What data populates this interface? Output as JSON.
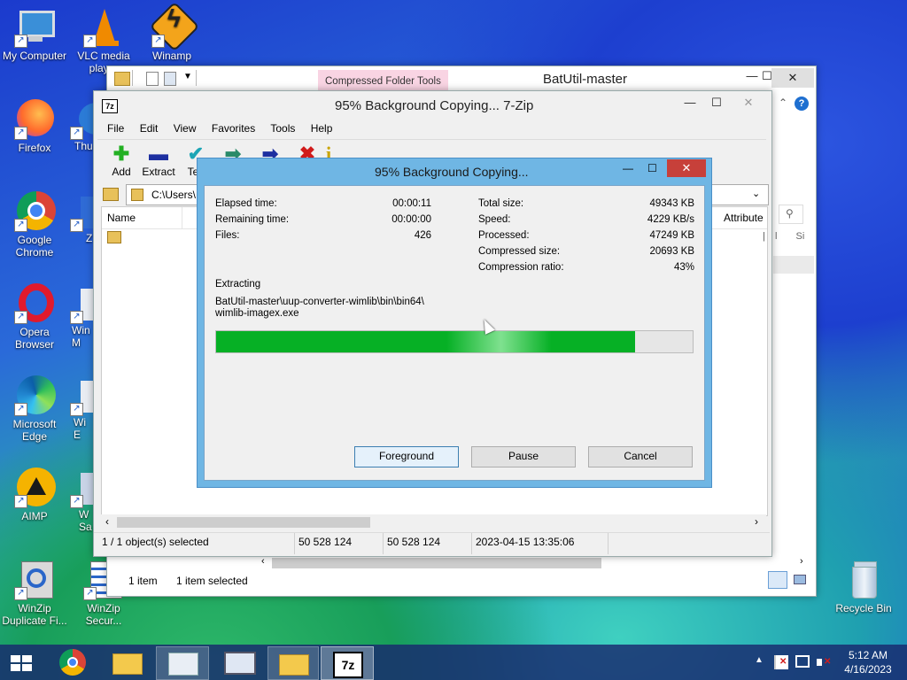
{
  "desktop": {
    "icons": [
      {
        "label": "My Computer"
      },
      {
        "label": "VLC media player"
      },
      {
        "label": "Winamp"
      },
      {
        "label": "Firefox"
      },
      {
        "label": "Thu"
      },
      {
        "label": "Google Chrome"
      },
      {
        "label": "Z"
      },
      {
        "label": "Opera Browser"
      },
      {
        "label": "Win M"
      },
      {
        "label": "Microsoft Edge"
      },
      {
        "label": "Wi E"
      },
      {
        "label": "AIMP"
      },
      {
        "label": "W Sa"
      },
      {
        "label": "WinZip Duplicate Fi..."
      },
      {
        "label": "WinZip Secur..."
      },
      {
        "label": "Recycle Bin"
      }
    ]
  },
  "explorer": {
    "title": "BatUtil-master",
    "ribbon_context": "Compressed Folder Tools",
    "status_items": "1 item",
    "status_selected": "1 item selected",
    "column_attributes": "Attribute",
    "col_frag_1": "l",
    "col_frag_2": "Si"
  },
  "sevenzip": {
    "title": "95% Background Copying... 7-Zip",
    "app_icon": "7z",
    "menu": [
      "File",
      "Edit",
      "View",
      "Favorites",
      "Tools",
      "Help"
    ],
    "toolbar": [
      {
        "label": "Add",
        "icon": "plus-icon",
        "glyph": "✚",
        "color": "#22b022"
      },
      {
        "label": "Extract",
        "icon": "minus-icon",
        "glyph": "▬",
        "color": "#1d2fa0"
      },
      {
        "label": "Tes",
        "icon": "check-icon",
        "glyph": "✔",
        "color": "#1ca5b5"
      },
      {
        "label": "",
        "icon": "copy-arrow-icon",
        "glyph": "➡",
        "color": "#2a8a6a"
      },
      {
        "label": "",
        "icon": "move-arrow-icon",
        "glyph": "➡",
        "color": "#1d2fa0"
      },
      {
        "label": "",
        "icon": "delete-icon",
        "glyph": "✖",
        "color": "#d11b1b"
      },
      {
        "label": "",
        "icon": "info-icon",
        "glyph": "i",
        "color": "#c9a400"
      }
    ],
    "path": "C:\\Users\\",
    "column_name": "Name",
    "status": {
      "selected": "1 / 1 object(s) selected",
      "size": "50 528 124",
      "packed": "50 528 124",
      "modified": "2023-04-15 13:35:06"
    }
  },
  "dialog": {
    "title": "95% Background Copying...",
    "left_stats": [
      {
        "label": "Elapsed time:",
        "value": "00:00:11"
      },
      {
        "label": "Remaining time:",
        "value": "00:00:00"
      },
      {
        "label": "Files:",
        "value": "426"
      }
    ],
    "right_stats": [
      {
        "label": "Total size:",
        "value": "49343 KB"
      },
      {
        "label": "Speed:",
        "value": "4229 KB/s"
      },
      {
        "label": "Processed:",
        "value": "47249 KB"
      },
      {
        "label": "Compressed size:",
        "value": "20693 KB"
      },
      {
        "label": "Compression ratio:",
        "value": "43%"
      }
    ],
    "operation": "Extracting",
    "file_line1": "BatUtil-master\\uup-converter-wimlib\\bin\\bin64\\",
    "file_line2": "wimlib-imagex.exe",
    "progress": 0.88,
    "buttons": {
      "foreground": "Foreground",
      "pause": "Pause",
      "cancel": "Cancel"
    }
  },
  "taskbar": {
    "time": "5:12 AM",
    "date": "4/16/2023",
    "active_app": "7z"
  },
  "colors": {
    "progress_fill": "#06b025",
    "close_red": "#c7403a",
    "dialog_frame": "#6fb6e4"
  }
}
